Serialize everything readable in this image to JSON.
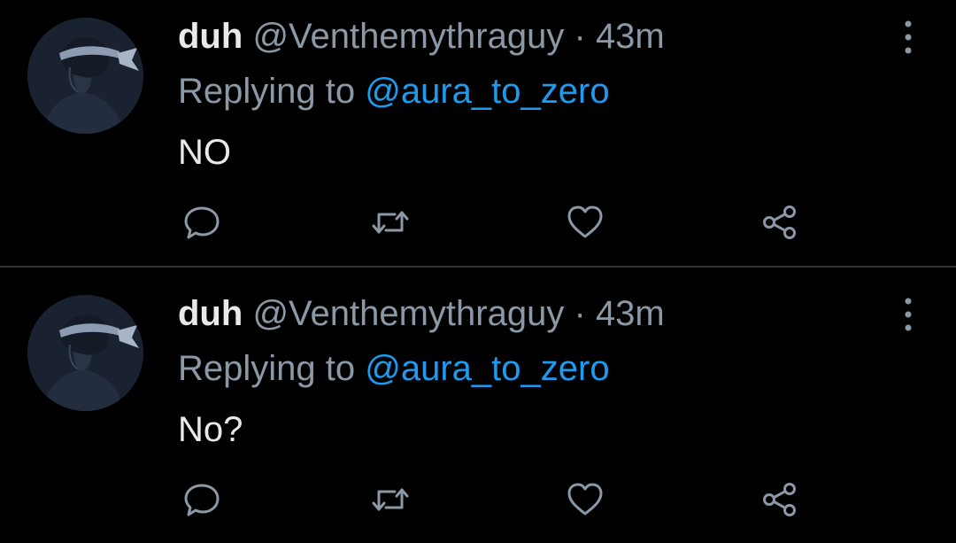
{
  "tweets": [
    {
      "author": {
        "name": "duh",
        "handle": "@Venthemythraguy",
        "separator": "·",
        "time": "43m"
      },
      "replying_prefix": "Replying to",
      "replying_to": "@aura_to_zero",
      "text": "NO",
      "icons": [
        "avatar",
        "more-icon",
        "reply-icon",
        "retweet-icon",
        "like-icon",
        "share-icon"
      ]
    },
    {
      "author": {
        "name": "duh",
        "handle": "@Venthemythraguy",
        "separator": "·",
        "time": "43m"
      },
      "replying_prefix": "Replying to",
      "replying_to": "@aura_to_zero",
      "text": "No?",
      "icons": [
        "avatar",
        "more-icon",
        "reply-icon",
        "retweet-icon",
        "like-icon",
        "share-icon"
      ]
    }
  ],
  "colors": {
    "background": "#000000",
    "primary_text": "#e7e9ea",
    "secondary_text": "#8b98a5",
    "accent": "#1d9bf0",
    "divider": "#2f3336"
  }
}
